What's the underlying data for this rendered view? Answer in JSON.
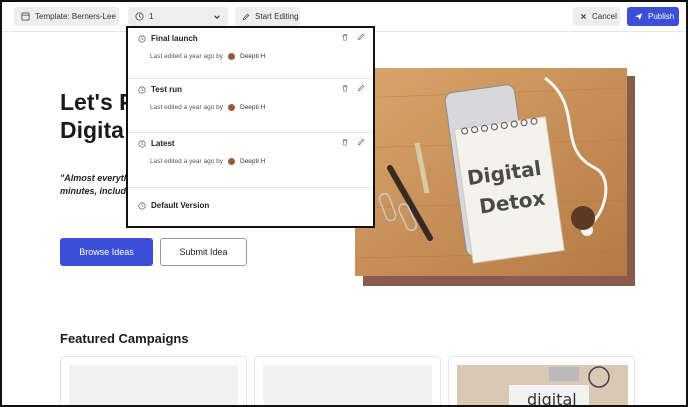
{
  "toolbar": {
    "template_label": "Template: Berners-Lee",
    "version_value": "1",
    "start_editing_label": "Start Editing",
    "cancel_label": "Cancel",
    "publish_label": "Publish"
  },
  "hero": {
    "title_line1": "Let's P",
    "title_line2": "Digita",
    "quote_line1": "\"Almost everyth",
    "quote_line2": "minutes, includi",
    "browse_label": "Browse Ideas",
    "submit_label": "Submit Idea",
    "image_text_line1": "Digital",
    "image_text_line2": "Detox"
  },
  "featured": {
    "title": "Featured Campaigns",
    "card3_text": "digital"
  },
  "versions": {
    "items": [
      {
        "name": "Final launch",
        "meta_prefix": "Last edited a year ago by",
        "user": "Deepti H"
      },
      {
        "name": "Test run",
        "meta_prefix": "Last edited a year ago by",
        "user": "Deepti H"
      },
      {
        "name": "Latest",
        "meta_prefix": "Last edited a year ago by",
        "user": "Deepti H"
      }
    ],
    "default_label": "Default Version"
  },
  "colors": {
    "accent": "#3b4fd8",
    "image_shadow": "#8a5a4c"
  }
}
